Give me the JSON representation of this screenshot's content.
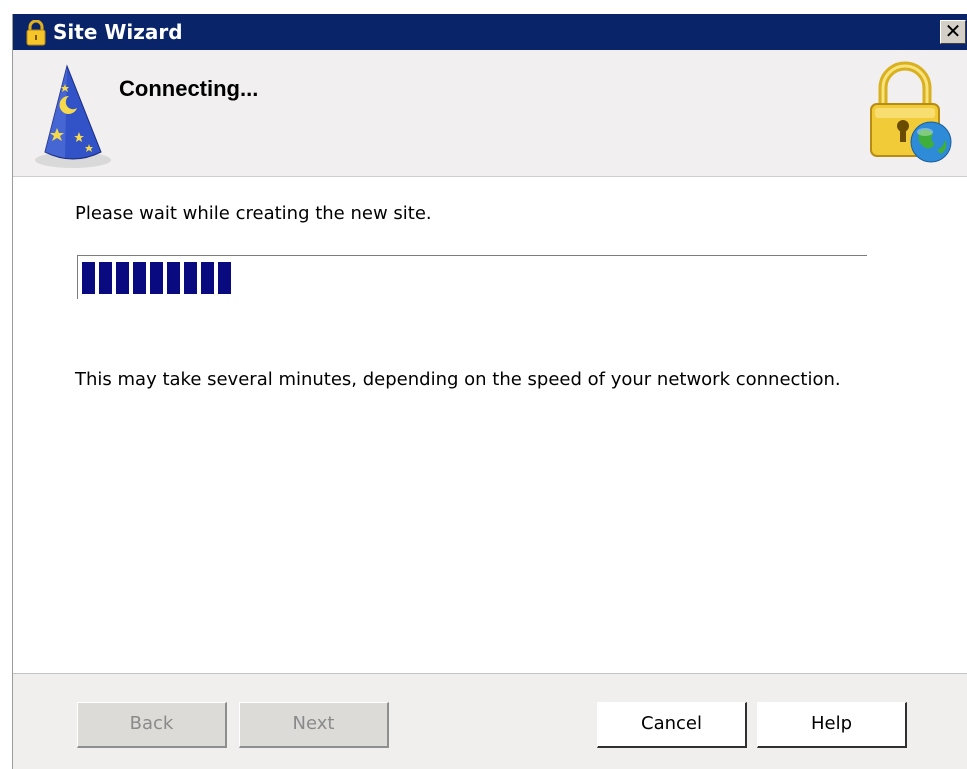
{
  "window": {
    "title": "Site Wizard",
    "close_glyph": "✕"
  },
  "header": {
    "heading": "Connecting...",
    "left_icon": "wizard-hat-icon",
    "right_icon": "lock-globe-icon"
  },
  "content": {
    "wait_message": "Please wait while creating the new site.",
    "progress_fraction": 0.2,
    "note": "This may take several minutes, depending on the speed of your network connection."
  },
  "buttons": {
    "back": "Back",
    "next": "Next",
    "cancel": "Cancel",
    "help": "Help"
  },
  "colors": {
    "titlebar": "#0a246a",
    "progress": "#0a0a80"
  }
}
